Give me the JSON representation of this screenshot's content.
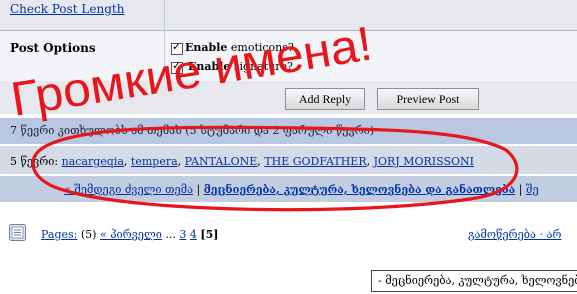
{
  "top": {
    "check_post_length": "Check Post Length"
  },
  "post_options": {
    "title": "Post Options",
    "opt1_bold": "Enable",
    "opt1_rest": " emoticons?",
    "opt2_bold": "Enable",
    "opt2_rest": " signature?"
  },
  "buttons": {
    "add_reply": "Add Reply",
    "preview_post": "Preview Post"
  },
  "viewers": {
    "text": "7 წევრი კითხულობს ამ თემას (5 სტუმარი და 2 ფარული წევრი)"
  },
  "members": {
    "prefix": "5 წევრი: ",
    "names": [
      "nacargeqia",
      "tempera",
      "PANTALONE",
      "THE GODFATHER",
      "JORJ MORISSONI"
    ]
  },
  "nav": {
    "prev": "« შემდეგი ძველი თემა",
    "forum": "მეცნიერება, კულტურა, ხელოვნება და განათლება",
    "next": "შე"
  },
  "pages": {
    "label": "Pages:",
    "count": "(5)",
    "first": "« პირველი",
    "ellipsis": "...",
    "p3": "3",
    "p4": "4",
    "current": "[5]"
  },
  "right_links": {
    "text": "გამოწერება · არ"
  },
  "dropdown": {
    "value": "- მეცნიერება, კულტურა, ხელოვნება"
  },
  "annotation": {
    "text": "Громкие имена!",
    "color": "#e8151b"
  },
  "colors": {
    "link": "#0033aa",
    "row_blue": "#b8c7e2",
    "row_grey": "#d4dae6"
  }
}
